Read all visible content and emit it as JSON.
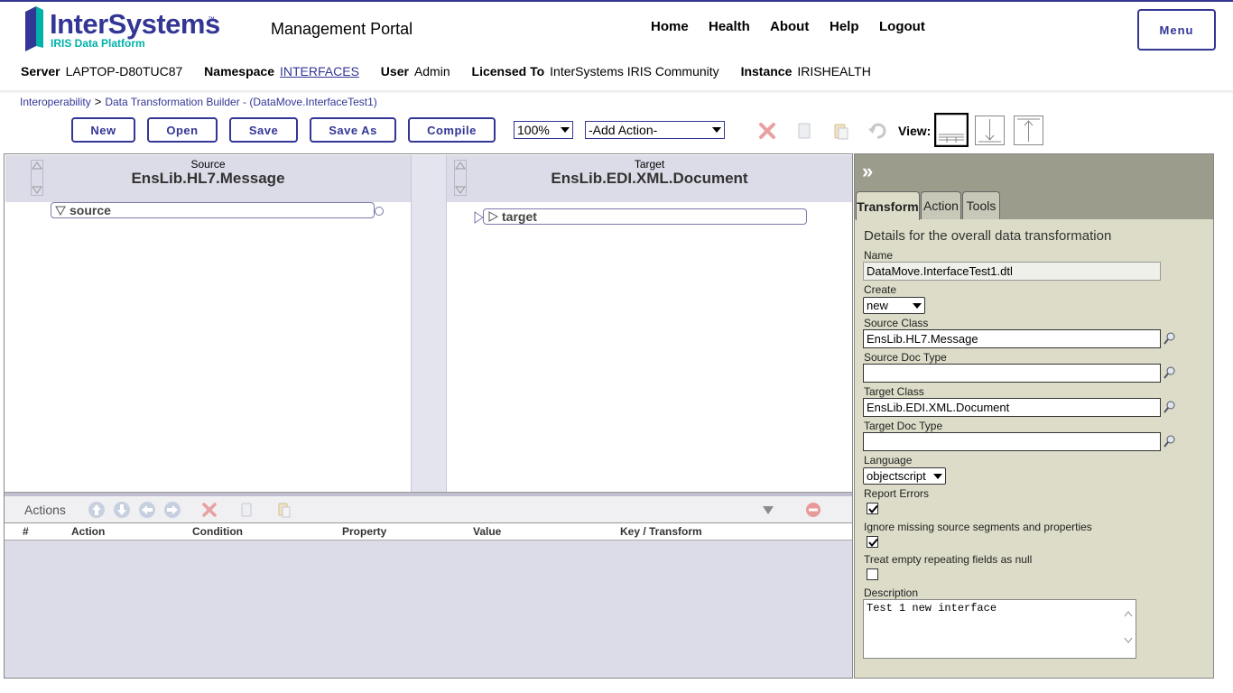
{
  "brand": {
    "name": "InterSystems",
    "tm": "™",
    "sub": "IRIS Data Platform",
    "colors": {
      "primary": "#333695",
      "teal": "#00b2a9"
    }
  },
  "header": {
    "title": "Management Portal",
    "nav": {
      "home": "Home",
      "health": "Health",
      "about": "About",
      "help": "Help",
      "logout": "Logout"
    },
    "menu_label": "Menu"
  },
  "info": {
    "server_label": "Server",
    "server": "LAPTOP-D80TUC87",
    "namespace_label": "Namespace",
    "namespace": "INTERFACES",
    "user_label": "User",
    "user": "Admin",
    "licensed_label": "Licensed To",
    "licensed": "InterSystems IRIS Community",
    "instance_label": "Instance",
    "instance": "IRISHEALTH"
  },
  "breadcrumb": {
    "items": [
      "Interoperability",
      "Data Transformation Builder"
    ],
    "separator": ">",
    "current": " - (DataMove.InterfaceTest1)"
  },
  "toolbar": {
    "new": "New",
    "open": "Open",
    "save": "Save",
    "save_as": "Save As",
    "compile": "Compile",
    "zoom": "100%",
    "add_action": "-Add Action-",
    "view_label": "View:",
    "icons": [
      "delete-icon",
      "copy-icon",
      "paste-icon",
      "undo-icon"
    ]
  },
  "source": {
    "caption": "Source",
    "class": "EnsLib.HL7.Message",
    "node": "source"
  },
  "target": {
    "caption": "Target",
    "class": "EnsLib.EDI.XML.Document",
    "node": "target"
  },
  "actions": {
    "label": "Actions",
    "columns": [
      "#",
      "Action",
      "Condition",
      "Property",
      "Value",
      "Key / Transform"
    ]
  },
  "panel": {
    "tabs": [
      "Transform",
      "Action",
      "Tools"
    ],
    "active_tab": "Transform",
    "title": "Details for the overall data transformation",
    "name_label": "Name",
    "name": "DataMove.InterfaceTest1.dtl",
    "create_label": "Create",
    "create": "new",
    "source_class_label": "Source Class",
    "source_class": "EnsLib.HL7.Message",
    "source_doc_type_label": "Source Doc Type",
    "source_doc_type": "",
    "target_class_label": "Target Class",
    "target_class": "EnsLib.EDI.XML.Document",
    "target_doc_type_label": "Target Doc Type",
    "target_doc_type": "",
    "language_label": "Language",
    "language": "objectscript",
    "report_errors_label": "Report Errors",
    "report_errors": true,
    "ignore_missing_label": "Ignore missing source segments and properties",
    "ignore_missing": true,
    "treat_empty_label": "Treat empty repeating fields as null",
    "treat_empty": false,
    "description_label": "Description",
    "description": "Test 1 new interface"
  }
}
